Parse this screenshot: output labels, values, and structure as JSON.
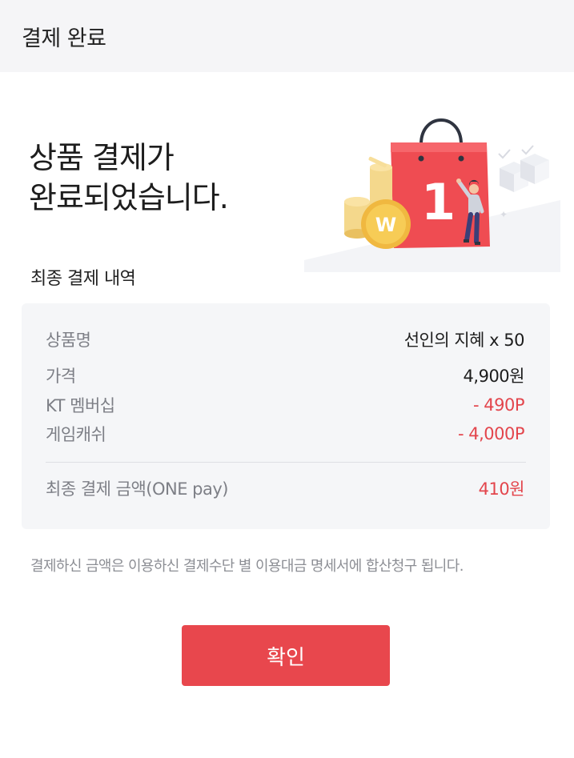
{
  "header": {
    "title": "결제 완료"
  },
  "headline": {
    "line1": "상품 결제가",
    "line2": "완료되었습니다."
  },
  "illustration": {
    "bag_number": "1",
    "coin_symbol": "W"
  },
  "summary": {
    "section_title": "최종 결제 내역",
    "rows": [
      {
        "label": "상품명",
        "value": "선인의 지혜 x 50"
      },
      {
        "label": "가격",
        "value": "4,900원"
      },
      {
        "label": "KT 멤버십",
        "value": "- 490P"
      },
      {
        "label": "게임캐쉬",
        "value": "- 4,000P"
      }
    ],
    "total": {
      "label": "최종 결제 금액(ONE pay)",
      "value": "410원"
    }
  },
  "notice": "결제하신 금액은 이용하신 결제수단 별 이용대금 명세서에 합산청구 됩니다.",
  "confirm_button": {
    "label": "확인"
  },
  "colors": {
    "accent": "#e8474d",
    "discount": "#e3454c",
    "header_bg": "#f5f5f7",
    "box_bg": "#f5f6f8"
  }
}
